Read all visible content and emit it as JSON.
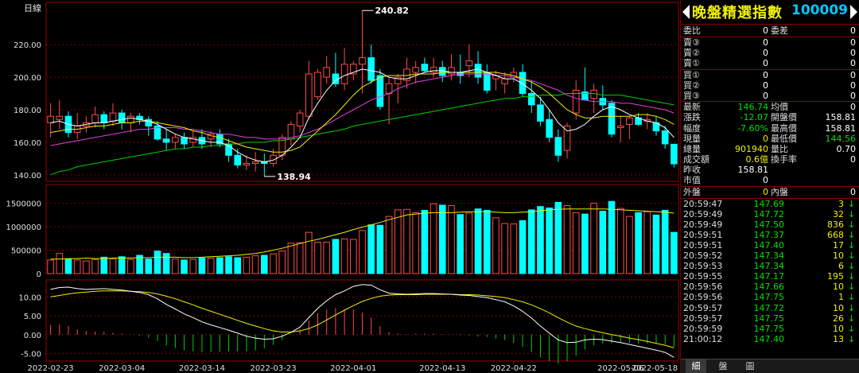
{
  "chart_label": "日線",
  "price_ticks": [
    "220.00",
    "200.00",
    "180.00",
    "160.00",
    "140.00"
  ],
  "volume_ticks": [
    "1500000",
    "1000000",
    "500000",
    "0"
  ],
  "macd_ticks": [
    "10.00",
    "5.00",
    "0.00",
    "-5.00"
  ],
  "dates": [
    "2022-02-23",
    "2022-03-04",
    "2022-03-14",
    "2022-03-23",
    "2022-04-01",
    "2022-04-13",
    "2022-04-22",
    "2022-05-06",
    "2022-05-18"
  ],
  "high_callout": "240.82",
  "low_callout": "138.94",
  "quote": {
    "title": "晚盤精選指數",
    "code": "100009",
    "commission_ratio_label": "委比",
    "commission_ratio": "0",
    "commission_diff_label": "委差",
    "commission_diff": "0",
    "sells": [
      {
        "label": "賣③",
        "price": "0",
        "vol": "0"
      },
      {
        "label": "賣②",
        "price": "0",
        "vol": "0"
      },
      {
        "label": "賣①",
        "price": "0",
        "vol": "0"
      }
    ],
    "buys": [
      {
        "label": "買①",
        "price": "0",
        "vol": "0"
      },
      {
        "label": "買②",
        "price": "0",
        "vol": "0"
      },
      {
        "label": "買③",
        "price": "0",
        "vol": "0"
      }
    ],
    "last_label": "最新",
    "last": "146.74",
    "avg_label": "均價",
    "avg": "0",
    "change_label": "漲跌",
    "change": "-12.07",
    "open_label": "開盤價",
    "open": "158.81",
    "range_label": "幅度",
    "range": "-7.60%",
    "high_label": "最高價",
    "high": "158.81",
    "cur_vol_label": "現量",
    "cur_vol": "0",
    "low_label": "最低價",
    "low": "144.56",
    "total_vol_label": "總量",
    "total_vol": "901940",
    "vol_ratio_label": "量比",
    "vol_ratio": "0.70",
    "turnover_label": "成交額",
    "turnover": "0.6億",
    "turnover_rate_label": "換手率",
    "turnover_rate": "0",
    "prev_close_label": "昨收",
    "prev_close": "158.81",
    "mkt_value_label": "市值",
    "mkt_value": "0",
    "outer_label": "外盤",
    "outer": "0",
    "inner_label": "內盤",
    "inner": "0"
  },
  "ticks": [
    {
      "time": "20:59:47",
      "price": "147.69",
      "vol": "3"
    },
    {
      "time": "20:59:49",
      "price": "147.72",
      "vol": "32"
    },
    {
      "time": "20:59:49",
      "price": "147.50",
      "vol": "836"
    },
    {
      "time": "20:59:51",
      "price": "147.37",
      "vol": "668"
    },
    {
      "time": "20:59:51",
      "price": "147.40",
      "vol": "17"
    },
    {
      "time": "20:59:52",
      "price": "147.34",
      "vol": "10"
    },
    {
      "time": "20:59:53",
      "price": "147.34",
      "vol": "6"
    },
    {
      "time": "20:59:55",
      "price": "147.17",
      "vol": "195"
    },
    {
      "time": "20:59:56",
      "price": "147.66",
      "vol": "10"
    },
    {
      "time": "20:59:56",
      "price": "147.75",
      "vol": "1"
    },
    {
      "time": "20:59:57",
      "price": "147.72",
      "vol": "10"
    },
    {
      "time": "20:59:57",
      "price": "147.75",
      "vol": "26"
    },
    {
      "time": "20:59:59",
      "price": "147.75",
      "vol": "10"
    },
    {
      "time": "21:00:12",
      "price": "147.40",
      "vol": "13"
    }
  ],
  "tabs": [
    "細",
    "盤",
    "圖"
  ],
  "colors": {
    "up": "#ff4a4a",
    "down": "#00ffff",
    "bg": "#000000",
    "grid": "#8a0000",
    "ma5": "#ffffff",
    "ma10": "#f0f000",
    "ma20": "#e040e0",
    "ma60": "#00d000"
  },
  "chart_data": {
    "type": "candlestick",
    "candles": [
      {
        "o": 172,
        "h": 184,
        "l": 163,
        "c": 176
      },
      {
        "o": 174,
        "h": 186,
        "l": 168,
        "c": 176
      },
      {
        "o": 176,
        "h": 179,
        "l": 163,
        "c": 166
      },
      {
        "o": 166,
        "h": 178,
        "l": 162,
        "c": 170
      },
      {
        "o": 170,
        "h": 176,
        "l": 166,
        "c": 172
      },
      {
        "o": 172,
        "h": 182,
        "l": 169,
        "c": 177
      },
      {
        "o": 177,
        "h": 179,
        "l": 168,
        "c": 172
      },
      {
        "o": 173,
        "h": 184,
        "l": 170,
        "c": 178
      },
      {
        "o": 178,
        "h": 180,
        "l": 168,
        "c": 172
      },
      {
        "o": 172,
        "h": 178,
        "l": 166,
        "c": 176
      },
      {
        "o": 176,
        "h": 178,
        "l": 171,
        "c": 174
      },
      {
        "o": 174,
        "h": 176,
        "l": 164,
        "c": 170
      },
      {
        "o": 170,
        "h": 173,
        "l": 161,
        "c": 162
      },
      {
        "o": 162,
        "h": 168,
        "l": 155,
        "c": 160
      },
      {
        "o": 160,
        "h": 165,
        "l": 156,
        "c": 163
      },
      {
        "o": 163,
        "h": 166,
        "l": 156,
        "c": 159
      },
      {
        "o": 160,
        "h": 167,
        "l": 157,
        "c": 163
      },
      {
        "o": 163,
        "h": 168,
        "l": 156,
        "c": 159
      },
      {
        "o": 162,
        "h": 167,
        "l": 157,
        "c": 165
      },
      {
        "o": 165,
        "h": 168,
        "l": 157,
        "c": 159
      },
      {
        "o": 159,
        "h": 162,
        "l": 148,
        "c": 152
      },
      {
        "o": 152,
        "h": 156,
        "l": 144,
        "c": 146
      },
      {
        "o": 146,
        "h": 152,
        "l": 143,
        "c": 147
      },
      {
        "o": 147,
        "h": 154,
        "l": 142,
        "c": 148
      },
      {
        "o": 148,
        "h": 153,
        "l": 139,
        "c": 147
      },
      {
        "o": 147,
        "h": 156,
        "l": 145,
        "c": 152
      },
      {
        "o": 152,
        "h": 165,
        "l": 149,
        "c": 163
      },
      {
        "o": 162,
        "h": 173,
        "l": 158,
        "c": 171
      },
      {
        "o": 170,
        "h": 180,
        "l": 166,
        "c": 178
      },
      {
        "o": 176,
        "h": 210,
        "l": 174,
        "c": 202
      },
      {
        "o": 188,
        "h": 205,
        "l": 186,
        "c": 203
      },
      {
        "o": 200,
        "h": 213,
        "l": 196,
        "c": 206
      },
      {
        "o": 202,
        "h": 215,
        "l": 194,
        "c": 196
      },
      {
        "o": 196,
        "h": 218,
        "l": 192,
        "c": 208
      },
      {
        "o": 202,
        "h": 210,
        "l": 198,
        "c": 208
      },
      {
        "o": 208,
        "h": 241,
        "l": 190,
        "c": 212
      },
      {
        "o": 212,
        "h": 220,
        "l": 196,
        "c": 198
      },
      {
        "o": 201,
        "h": 205,
        "l": 180,
        "c": 182
      },
      {
        "o": 190,
        "h": 200,
        "l": 171,
        "c": 196
      },
      {
        "o": 196,
        "h": 202,
        "l": 184,
        "c": 200
      },
      {
        "o": 198,
        "h": 212,
        "l": 193,
        "c": 205
      },
      {
        "o": 203,
        "h": 210,
        "l": 196,
        "c": 206
      },
      {
        "o": 208,
        "h": 212,
        "l": 203,
        "c": 204
      },
      {
        "o": 203,
        "h": 212,
        "l": 200,
        "c": 206
      },
      {
        "o": 206,
        "h": 210,
        "l": 197,
        "c": 201
      },
      {
        "o": 202,
        "h": 214,
        "l": 198,
        "c": 206
      },
      {
        "o": 203,
        "h": 214,
        "l": 196,
        "c": 201
      },
      {
        "o": 207,
        "h": 220,
        "l": 200,
        "c": 210
      },
      {
        "o": 208,
        "h": 216,
        "l": 196,
        "c": 200
      },
      {
        "o": 203,
        "h": 208,
        "l": 190,
        "c": 192
      },
      {
        "o": 199,
        "h": 204,
        "l": 192,
        "c": 201
      },
      {
        "o": 196,
        "h": 203,
        "l": 190,
        "c": 199
      },
      {
        "o": 200,
        "h": 206,
        "l": 197,
        "c": 203
      },
      {
        "o": 203,
        "h": 208,
        "l": 188,
        "c": 190
      },
      {
        "o": 190,
        "h": 198,
        "l": 178,
        "c": 183
      },
      {
        "o": 183,
        "h": 188,
        "l": 170,
        "c": 173
      },
      {
        "o": 174,
        "h": 180,
        "l": 160,
        "c": 163
      },
      {
        "o": 163,
        "h": 168,
        "l": 148,
        "c": 152
      },
      {
        "o": 155,
        "h": 172,
        "l": 150,
        "c": 170
      },
      {
        "o": 178,
        "h": 198,
        "l": 174,
        "c": 192
      },
      {
        "o": 191,
        "h": 206,
        "l": 186,
        "c": 186
      },
      {
        "o": 187,
        "h": 196,
        "l": 178,
        "c": 192
      },
      {
        "o": 187,
        "h": 195,
        "l": 180,
        "c": 183
      },
      {
        "o": 184,
        "h": 186,
        "l": 163,
        "c": 165
      },
      {
        "o": 169,
        "h": 176,
        "l": 160,
        "c": 170
      },
      {
        "o": 171,
        "h": 176,
        "l": 162,
        "c": 175
      },
      {
        "o": 175,
        "h": 178,
        "l": 170,
        "c": 171
      },
      {
        "o": 173,
        "h": 178,
        "l": 168,
        "c": 174
      },
      {
        "o": 172,
        "h": 176,
        "l": 164,
        "c": 167
      },
      {
        "o": 167,
        "h": 170,
        "l": 156,
        "c": 159
      },
      {
        "o": 158.81,
        "h": 158.81,
        "l": 144.56,
        "c": 146.74
      }
    ],
    "ma5": [
      172,
      173,
      171,
      170,
      171,
      172,
      172,
      173,
      174,
      175,
      174,
      173,
      171,
      168,
      165,
      163,
      162,
      161,
      160,
      160,
      158,
      154,
      151,
      149,
      148,
      149,
      152,
      157,
      163,
      175,
      184,
      192,
      198,
      201,
      203,
      205,
      204,
      203,
      200,
      199,
      199,
      201,
      203,
      204,
      204,
      203,
      203,
      204,
      205,
      203,
      201,
      199,
      199,
      196,
      192,
      187,
      180,
      172,
      167,
      168,
      171,
      176,
      180,
      182,
      180,
      177,
      175,
      173,
      172,
      169,
      163
    ],
    "ma10": [
      166,
      167,
      168,
      168,
      169,
      170,
      170,
      171,
      172,
      172,
      173,
      173,
      172,
      171,
      170,
      169,
      167,
      166,
      164,
      163,
      161,
      159,
      157,
      156,
      155,
      154,
      154,
      155,
      157,
      162,
      167,
      172,
      177,
      183,
      189,
      194,
      197,
      200,
      201,
      201,
      201,
      202,
      202,
      202,
      203,
      203,
      203,
      203,
      203,
      203,
      203,
      202,
      201,
      199,
      197,
      194,
      190,
      185,
      180,
      177,
      175,
      175,
      176,
      176,
      176,
      176,
      177,
      177,
      176,
      174,
      171
    ],
    "ma20": [
      158,
      159,
      160,
      161,
      162,
      163,
      164,
      165,
      166,
      167,
      168,
      168,
      169,
      169,
      169,
      168,
      168,
      167,
      166,
      165,
      165,
      164,
      163,
      163,
      162,
      162,
      162,
      163,
      164,
      166,
      168,
      171,
      174,
      177,
      180,
      183,
      186,
      188,
      190,
      193,
      195,
      197,
      198,
      199,
      200,
      201,
      202,
      202,
      202,
      202,
      201,
      201,
      200,
      199,
      198,
      196,
      194,
      192,
      189,
      187,
      186,
      185,
      185,
      185,
      184,
      184,
      183,
      182,
      181,
      180,
      178
    ],
    "ma60": [
      140,
      142,
      143,
      145,
      146,
      147,
      148,
      149,
      150,
      151,
      152,
      153,
      154,
      155,
      156,
      156,
      157,
      157,
      158,
      158,
      159,
      159,
      160,
      160,
      160,
      161,
      161,
      162,
      163,
      164,
      165,
      166,
      167,
      168,
      170,
      171,
      172,
      173,
      174,
      175,
      176,
      177,
      178,
      179,
      180,
      181,
      182,
      183,
      184,
      185,
      186,
      187,
      187,
      188,
      188,
      189,
      189,
      189,
      190,
      190,
      190,
      190,
      189,
      189,
      189,
      188,
      187,
      186,
      185,
      184,
      183
    ],
    "volume": [
      290000,
      430000,
      310000,
      290000,
      270000,
      300000,
      350000,
      310000,
      360000,
      300000,
      390000,
      310000,
      480000,
      430000,
      310000,
      290000,
      300000,
      330000,
      330000,
      340000,
      360000,
      340000,
      350000,
      380000,
      390000,
      420000,
      480000,
      650000,
      660000,
      880000,
      670000,
      670000,
      730000,
      740000,
      730000,
      920000,
      1040000,
      1030000,
      1220000,
      1360000,
      1370000,
      1300000,
      1350000,
      1490000,
      1460000,
      1450000,
      1260000,
      1290000,
      1380000,
      1350000,
      1190000,
      1070000,
      1060000,
      1130000,
      1360000,
      1430000,
      1400000,
      1520000,
      1450000,
      1300000,
      1270000,
      1500000,
      1330000,
      1540000,
      1390000,
      1220000,
      1300000,
      1320000,
      1250000,
      1350000,
      880000
    ],
    "volume_ma": [
      310000,
      310000,
      320000,
      320000,
      330000,
      320000,
      320000,
      330000,
      330000,
      330000,
      340000,
      340000,
      350000,
      350000,
      350000,
      340000,
      340000,
      350000,
      360000,
      370000,
      380000,
      390000,
      410000,
      430000,
      460000,
      500000,
      540000,
      590000,
      640000,
      690000,
      730000,
      780000,
      830000,
      880000,
      940000,
      990000,
      1040000,
      1090000,
      1150000,
      1200000,
      1250000,
      1270000,
      1290000,
      1300000,
      1300000,
      1300000,
      1310000,
      1320000,
      1320000,
      1320000,
      1310000,
      1300000,
      1300000,
      1310000,
      1320000,
      1340000,
      1360000,
      1370000,
      1380000,
      1380000,
      1380000,
      1380000,
      1380000,
      1370000,
      1360000,
      1350000,
      1340000,
      1330000,
      1320000,
      1310000,
      1290000
    ],
    "dif": [
      12,
      12.5,
      12.6,
      12.2,
      12,
      12.1,
      12.2,
      12,
      11.8,
      11.5,
      11.2,
      10.6,
      9.5,
      8,
      6.8,
      5.5,
      4.5,
      3.4,
      2.6,
      1.9,
      1.2,
      0.4,
      -0.4,
      -0.9,
      -1.2,
      -1.1,
      -0.4,
      0.6,
      2,
      4.5,
      7,
      9,
      10.6,
      11.6,
      12.8,
      13.3,
      13.1,
      11.9,
      11,
      10.8,
      10.7,
      10.8,
      10.9,
      10.9,
      10.8,
      10.7,
      10.5,
      10.4,
      10.1,
      9.8,
      9.3,
      8.7,
      7.6,
      6.2,
      4.4,
      2.3,
      0.4,
      -1.4,
      -2.1,
      -2,
      -1.4,
      -1.2,
      -1.3,
      -1.7,
      -2.1,
      -2.6,
      -3.1,
      -3.6,
      -4.1,
      -4.7,
      -6
    ],
    "dea": [
      10,
      10.4,
      10.8,
      11.1,
      11.3,
      11.5,
      11.6,
      11.6,
      11.6,
      11.5,
      11.4,
      11.2,
      10.8,
      10.2,
      9.5,
      8.7,
      7.9,
      7,
      6.2,
      5.4,
      4.6,
      3.8,
      3,
      2.3,
      1.6,
      1,
      0.7,
      0.7,
      1,
      1.6,
      2.6,
      3.9,
      5.2,
      6.5,
      7.7,
      8.8,
      9.6,
      10.2,
      10.5,
      10.6,
      10.6,
      10.6,
      10.7,
      10.7,
      10.7,
      10.7,
      10.6,
      10.6,
      10.5,
      10.3,
      10.1,
      9.8,
      9.3,
      8.7,
      7.9,
      6.9,
      5.8,
      4.5,
      3.3,
      2.3,
      1.6,
      1,
      0.5,
      0,
      -0.4,
      -0.9,
      -1.3,
      -1.8,
      -2.3,
      -2.8,
      -3.5
    ]
  }
}
